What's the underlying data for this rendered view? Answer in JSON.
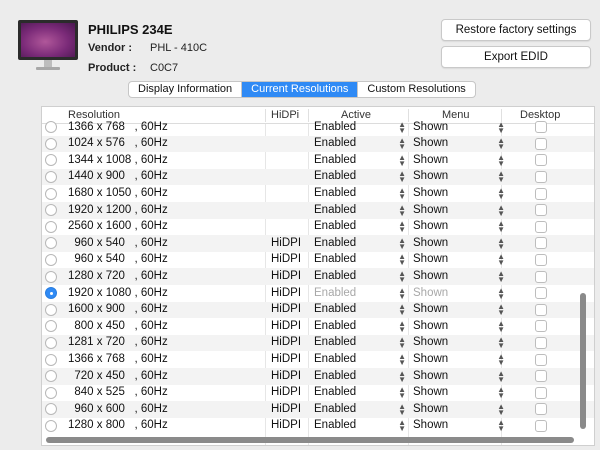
{
  "monitor": {
    "name": "PHILIPS 234E",
    "vendor_label": "Vendor :",
    "vendor_value": "PHL - 410C",
    "product_label": "Product :",
    "product_value": "C0C7"
  },
  "buttons": {
    "restore": "Restore factory settings",
    "export": "Export EDID"
  },
  "tabs": [
    {
      "label": "Display Information",
      "active": false
    },
    {
      "label": "Current Resolutions",
      "active": true
    },
    {
      "label": "Custom Resolutions",
      "active": false
    }
  ],
  "table": {
    "columns": [
      "Resolution",
      "HiDPi",
      "Active",
      "Menu",
      "Desktop"
    ],
    "rows": [
      {
        "res": "1366 x 768   , 60Hz",
        "hidpi": "",
        "active": "Enabled",
        "menu": "Shown",
        "selected": false,
        "disabled": false
      },
      {
        "res": "1024 x 576   , 60Hz",
        "hidpi": "",
        "active": "Enabled",
        "menu": "Shown",
        "selected": false,
        "disabled": false
      },
      {
        "res": "1344 x 1008 , 60Hz",
        "hidpi": "",
        "active": "Enabled",
        "menu": "Shown",
        "selected": false,
        "disabled": false
      },
      {
        "res": "1440 x 900   , 60Hz",
        "hidpi": "",
        "active": "Enabled",
        "menu": "Shown",
        "selected": false,
        "disabled": false
      },
      {
        "res": "1680 x 1050 , 60Hz",
        "hidpi": "",
        "active": "Enabled",
        "menu": "Shown",
        "selected": false,
        "disabled": false
      },
      {
        "res": "1920 x 1200 , 60Hz",
        "hidpi": "",
        "active": "Enabled",
        "menu": "Shown",
        "selected": false,
        "disabled": false
      },
      {
        "res": "2560 x 1600 , 60Hz",
        "hidpi": "",
        "active": "Enabled",
        "menu": "Shown",
        "selected": false,
        "disabled": false
      },
      {
        "res": "  960 x 540   , 60Hz",
        "hidpi": "HiDPI",
        "active": "Enabled",
        "menu": "Shown",
        "selected": false,
        "disabled": false
      },
      {
        "res": "  960 x 540   , 60Hz",
        "hidpi": "HiDPI",
        "active": "Enabled",
        "menu": "Shown",
        "selected": false,
        "disabled": false
      },
      {
        "res": "1280 x 720   , 60Hz",
        "hidpi": "HiDPI",
        "active": "Enabled",
        "menu": "Shown",
        "selected": false,
        "disabled": false
      },
      {
        "res": "1920 x 1080 , 60Hz",
        "hidpi": "HiDPI",
        "active": "Enabled",
        "menu": "Shown",
        "selected": true,
        "disabled": true
      },
      {
        "res": "1600 x 900   , 60Hz",
        "hidpi": "HiDPI",
        "active": "Enabled",
        "menu": "Shown",
        "selected": false,
        "disabled": false
      },
      {
        "res": "  800 x 450   , 60Hz",
        "hidpi": "HiDPI",
        "active": "Enabled",
        "menu": "Shown",
        "selected": false,
        "disabled": false
      },
      {
        "res": "1281 x 720   , 60Hz",
        "hidpi": "HiDPI",
        "active": "Enabled",
        "menu": "Shown",
        "selected": false,
        "disabled": false
      },
      {
        "res": "1366 x 768   , 60Hz",
        "hidpi": "HiDPI",
        "active": "Enabled",
        "menu": "Shown",
        "selected": false,
        "disabled": false
      },
      {
        "res": "  720 x 450   , 60Hz",
        "hidpi": "HiDPI",
        "active": "Enabled",
        "menu": "Shown",
        "selected": false,
        "disabled": false
      },
      {
        "res": "  840 x 525   , 60Hz",
        "hidpi": "HiDPI",
        "active": "Enabled",
        "menu": "Shown",
        "selected": false,
        "disabled": false
      },
      {
        "res": "  960 x 600   , 60Hz",
        "hidpi": "HiDPI",
        "active": "Enabled",
        "menu": "Shown",
        "selected": false,
        "disabled": false
      },
      {
        "res": "1280 x 800   , 60Hz",
        "hidpi": "HiDPI",
        "active": "Enabled",
        "menu": "Shown",
        "selected": false,
        "disabled": false
      }
    ]
  },
  "colors": {
    "accent": "#2f8af5",
    "disabled_text": "#a8a8a8"
  },
  "icons": {
    "monitor": "monitor-icon",
    "popup": "popup-chevron-icon",
    "radio": "radio-button",
    "checkbox": "checkbox"
  }
}
